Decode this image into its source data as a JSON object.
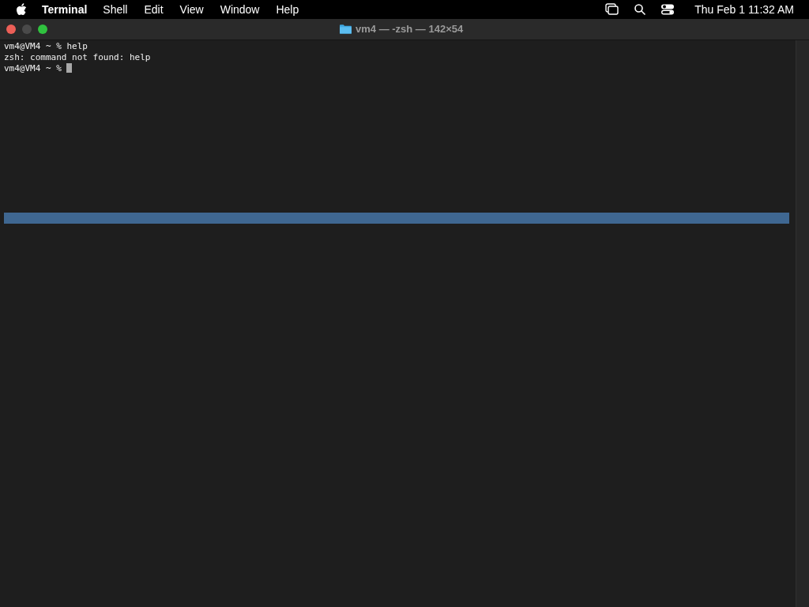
{
  "menu_bar": {
    "app_name": "Terminal",
    "items": [
      "Shell",
      "Edit",
      "View",
      "Window",
      "Help"
    ],
    "clock": "Thu Feb 1  11:32 AM"
  },
  "window": {
    "title": "vm4 — -zsh — 142×54"
  },
  "terminal": {
    "lines": [
      "vm4@VM4 ~ % help",
      "zsh: command not found: help",
      "vm4@VM4 ~ % "
    ],
    "cursor": true
  }
}
